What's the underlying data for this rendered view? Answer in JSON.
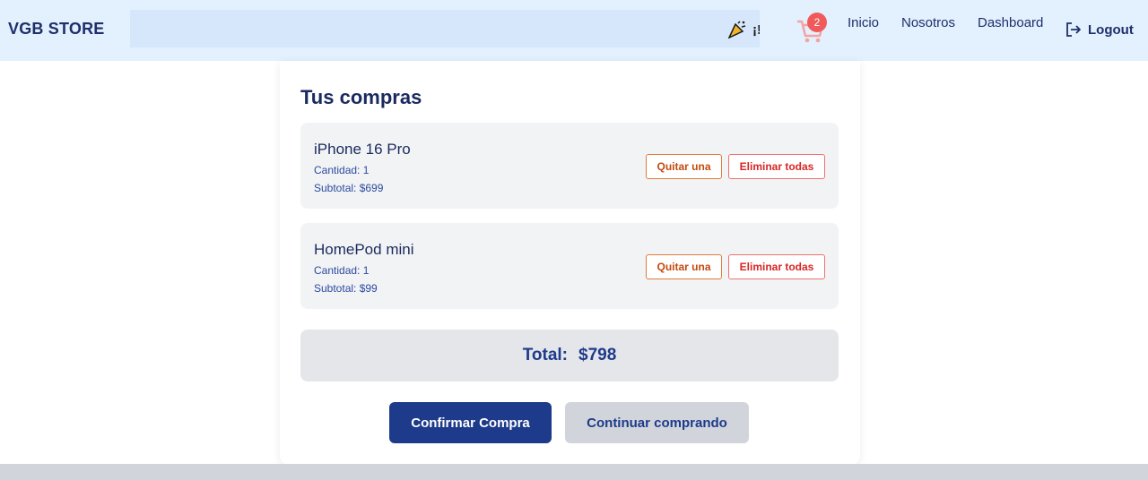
{
  "navbar": {
    "brand": "VGB STORE",
    "marquee_text": "¡!",
    "marquee_icon": "party-popper-icon",
    "cart_icon": "shopping-cart-icon",
    "cart_count": "2",
    "links": [
      "Inicio",
      "Nosotros",
      "Dashboard"
    ],
    "logout_label": "Logout",
    "logout_icon": "logout-icon"
  },
  "cart": {
    "title": "Tus compras",
    "items": [
      {
        "name": "iPhone 16 Pro",
        "quantity": "Cantidad: 1",
        "subtotal": "Subtotal: $699",
        "remove_one": "Quitar una",
        "remove_all": "Eliminar todas"
      },
      {
        "name": "HomePod mini",
        "quantity": "Cantidad: 1",
        "subtotal": "Subtotal: $99",
        "remove_one": "Quitar una",
        "remove_all": "Eliminar todas"
      }
    ],
    "total_label": "Total:",
    "total_value": "$798",
    "confirm_label": "Confirmar Compra",
    "continue_label": "Continuar comprando"
  },
  "colors": {
    "primary": "#1e3a8a",
    "navbar_bg": "#e3f0fd",
    "badge": "#f05a5a",
    "remove_one_border": "#e07b39",
    "remove_all_border": "#f07070"
  }
}
